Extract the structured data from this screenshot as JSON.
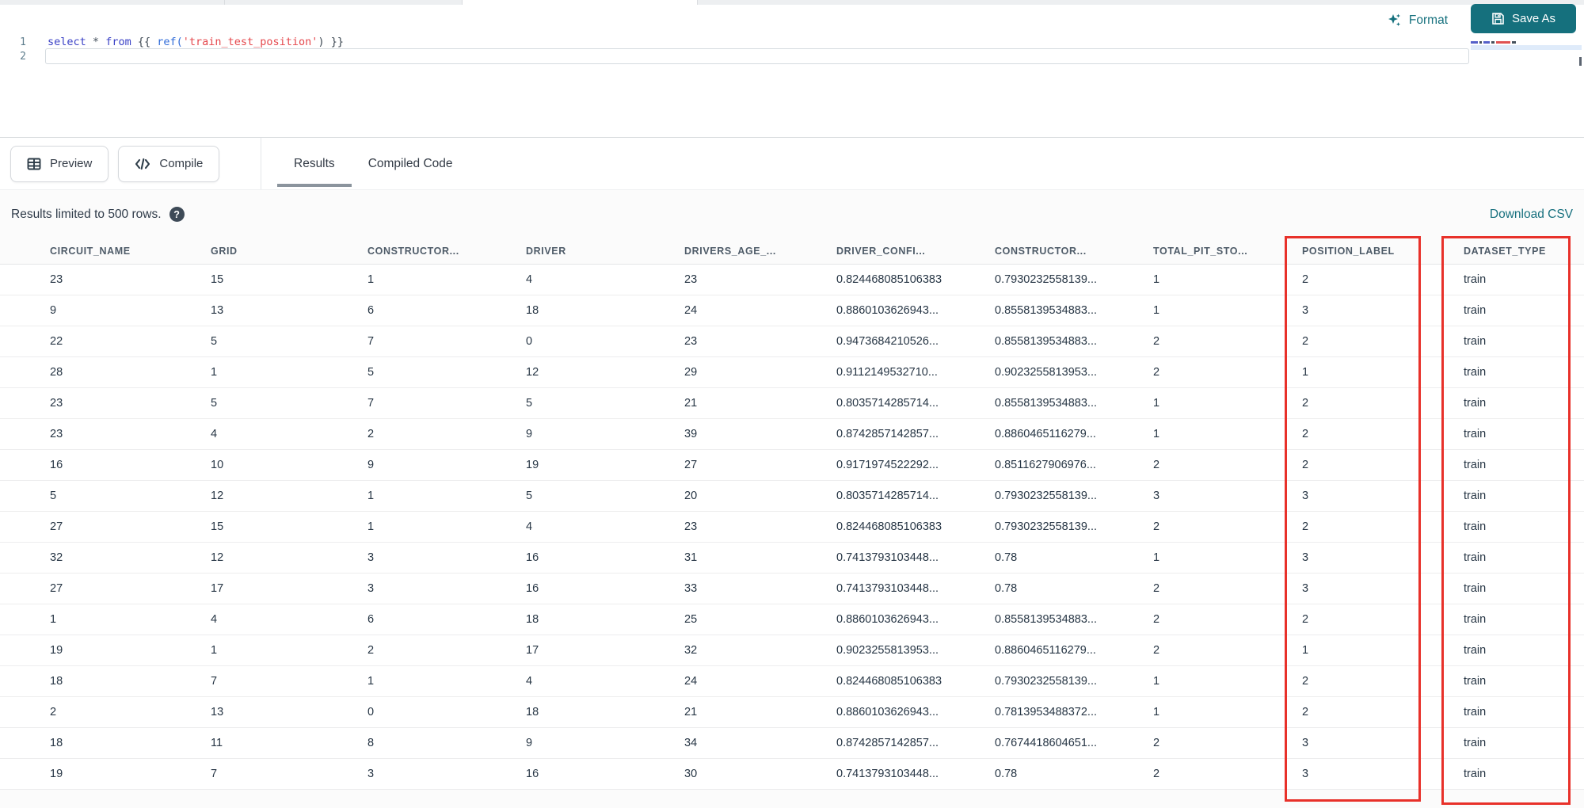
{
  "colors": {
    "accent_teal": "#15707d",
    "highlight_red": "#e8312a",
    "keyword_blue": "#3a41c6",
    "function_blue": "#2f6bd8",
    "string_red": "#e5484d"
  },
  "top_toolbar": {
    "format_label": "Format",
    "save_as_label": "Save As"
  },
  "editor": {
    "line_numbers": [
      "1",
      "2"
    ],
    "code_line_tokens": [
      {
        "text": "select",
        "type": "keyword"
      },
      {
        "text": " ",
        "type": "plain"
      },
      {
        "text": "*",
        "type": "operator"
      },
      {
        "text": " ",
        "type": "plain"
      },
      {
        "text": "from",
        "type": "keyword"
      },
      {
        "text": " {{ ",
        "type": "plain"
      },
      {
        "text": "ref(",
        "type": "function"
      },
      {
        "text": "'train_test_position'",
        "type": "string"
      },
      {
        "text": ") }}",
        "type": "plain"
      }
    ]
  },
  "results_toolbar": {
    "preview_label": "Preview",
    "compile_label": "Compile",
    "tabs": [
      {
        "label": "Results",
        "active": true
      },
      {
        "label": "Compiled Code",
        "active": false
      }
    ]
  },
  "results_info": {
    "limit_text": "Results limited to 500 rows.",
    "download_label": "Download CSV"
  },
  "table": {
    "columns": [
      "CIRCUIT_NAME",
      "GRID",
      "CONSTRUCTOR...",
      "DRIVER",
      "DRIVERS_AGE_...",
      "DRIVER_CONFI...",
      "CONSTRUCTOR...",
      "TOTAL_PIT_STO...",
      "POSITION_LABEL",
      "DATASET_TYPE"
    ],
    "highlighted_columns": [
      "POSITION_LABEL",
      "DATASET_TYPE"
    ],
    "rows": [
      [
        "23",
        "15",
        "1",
        "4",
        "23",
        "0.824468085106383",
        "0.7930232558139...",
        "1",
        "2",
        "train"
      ],
      [
        "9",
        "13",
        "6",
        "18",
        "24",
        "0.8860103626943...",
        "0.8558139534883...",
        "1",
        "3",
        "train"
      ],
      [
        "22",
        "5",
        "7",
        "0",
        "23",
        "0.9473684210526...",
        "0.8558139534883...",
        "2",
        "2",
        "train"
      ],
      [
        "28",
        "1",
        "5",
        "12",
        "29",
        "0.9112149532710...",
        "0.9023255813953...",
        "2",
        "1",
        "train"
      ],
      [
        "23",
        "5",
        "7",
        "5",
        "21",
        "0.8035714285714...",
        "0.8558139534883...",
        "1",
        "2",
        "train"
      ],
      [
        "23",
        "4",
        "2",
        "9",
        "39",
        "0.8742857142857...",
        "0.8860465116279...",
        "1",
        "2",
        "train"
      ],
      [
        "16",
        "10",
        "9",
        "19",
        "27",
        "0.9171974522292...",
        "0.8511627906976...",
        "2",
        "2",
        "train"
      ],
      [
        "5",
        "12",
        "1",
        "5",
        "20",
        "0.8035714285714...",
        "0.7930232558139...",
        "3",
        "3",
        "train"
      ],
      [
        "27",
        "15",
        "1",
        "4",
        "23",
        "0.824468085106383",
        "0.7930232558139...",
        "2",
        "2",
        "train"
      ],
      [
        "32",
        "12",
        "3",
        "16",
        "31",
        "0.7413793103448...",
        "0.78",
        "1",
        "3",
        "train"
      ],
      [
        "27",
        "17",
        "3",
        "16",
        "33",
        "0.7413793103448...",
        "0.78",
        "2",
        "3",
        "train"
      ],
      [
        "1",
        "4",
        "6",
        "18",
        "25",
        "0.8860103626943...",
        "0.8558139534883...",
        "2",
        "2",
        "train"
      ],
      [
        "19",
        "1",
        "2",
        "17",
        "32",
        "0.9023255813953...",
        "0.8860465116279...",
        "2",
        "1",
        "train"
      ],
      [
        "18",
        "7",
        "1",
        "4",
        "24",
        "0.824468085106383",
        "0.7930232558139...",
        "1",
        "2",
        "train"
      ],
      [
        "2",
        "13",
        "0",
        "18",
        "21",
        "0.8860103626943...",
        "0.7813953488372...",
        "1",
        "2",
        "train"
      ],
      [
        "18",
        "11",
        "8",
        "9",
        "34",
        "0.8742857142857...",
        "0.7674418604651...",
        "2",
        "3",
        "train"
      ],
      [
        "19",
        "7",
        "3",
        "16",
        "30",
        "0.7413793103448...",
        "0.78",
        "2",
        "3",
        "train"
      ]
    ]
  }
}
